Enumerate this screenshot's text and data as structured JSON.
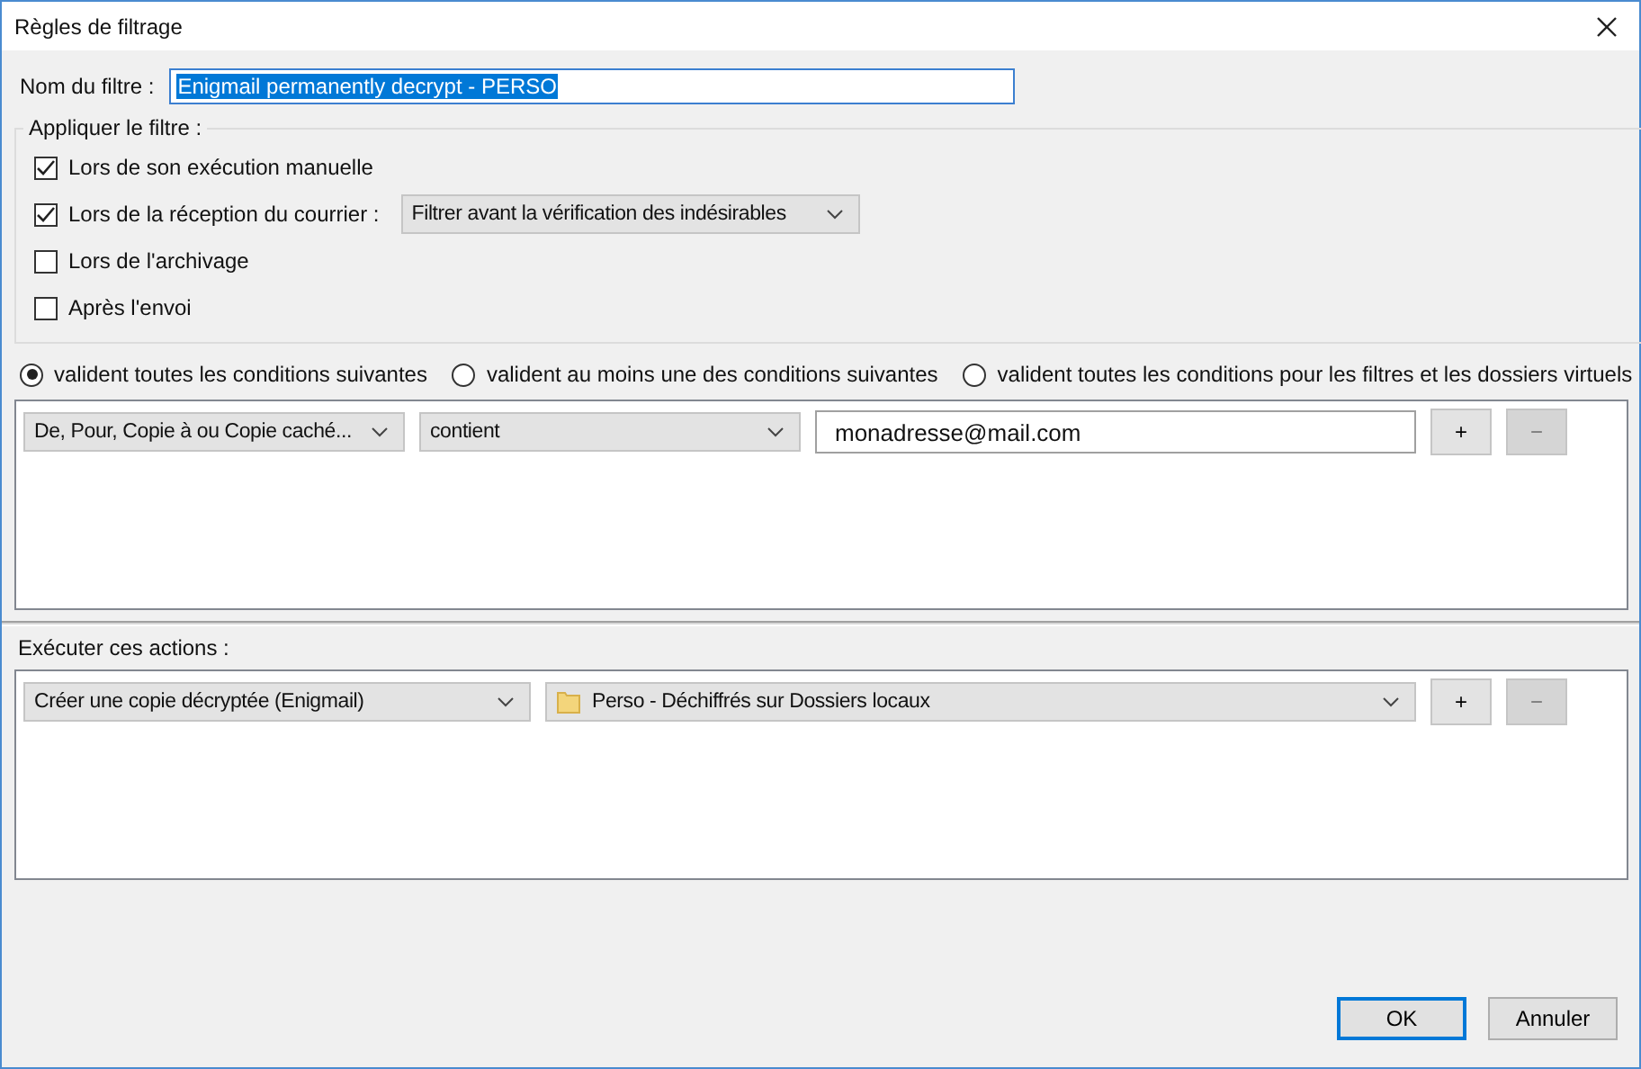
{
  "window": {
    "title": "Règles de filtrage"
  },
  "filter_name": {
    "label": "Nom du filtre :",
    "value": "Enigmail permanently decrypt - PERSO"
  },
  "apply": {
    "legend": "Appliquer le filtre :",
    "options": [
      {
        "label": "Lors de son exécution manuelle",
        "checked": true
      },
      {
        "label": "Lors de la réception du courrier :",
        "checked": true,
        "dropdown": "Filtrer avant la vérification des indésirables"
      },
      {
        "label": "Lors de l'archivage",
        "checked": false
      },
      {
        "label": "Après l'envoi",
        "checked": false
      }
    ]
  },
  "match": [
    {
      "label": "valident toutes les conditions suivantes",
      "selected": true
    },
    {
      "label": "valident au moins une des conditions suivantes",
      "selected": false
    },
    {
      "label": "valident toutes les conditions pour les filtres et les dossiers virtuels",
      "selected": false
    }
  ],
  "conditions": [
    {
      "field": "De, Pour, Copie à ou Copie caché...",
      "operator": "contient",
      "value": "monadresse@mail.com",
      "add": "+",
      "remove": "−",
      "remove_disabled": true
    }
  ],
  "actions_label": "Exécuter ces actions :",
  "actions": [
    {
      "action": "Créer une copie décryptée (Enigmail)",
      "target": "Perso - Déchiffrés sur Dossiers locaux",
      "add": "+",
      "remove": "−",
      "remove_disabled": true
    }
  ],
  "buttons": [
    {
      "label": "OK",
      "default": true
    },
    {
      "label": "Annuler",
      "default": false
    }
  ]
}
